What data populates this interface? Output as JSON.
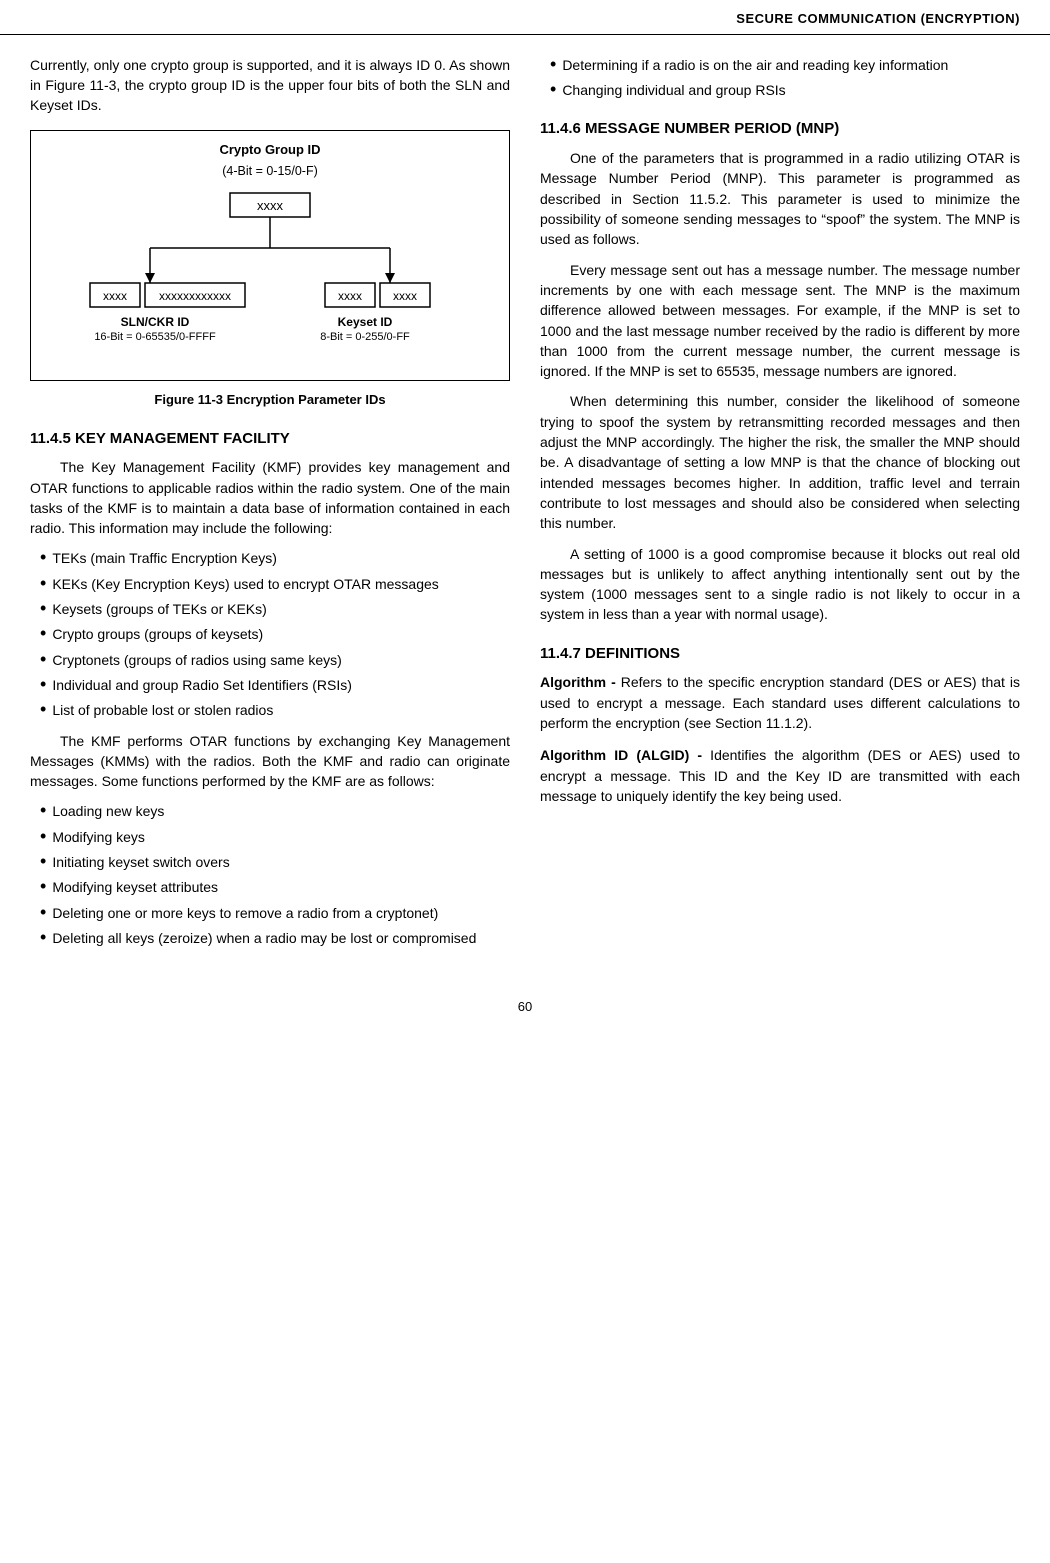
{
  "header": {
    "title": "SECURE COMMUNICATION (ENCRYPTION)"
  },
  "left_col": {
    "intro_paragraph": "Currently, only one crypto group is supported, and it is always ID 0. As shown in Figure 11-3, the crypto group ID is the upper four bits of both the SLN and Keyset IDs.",
    "diagram": {
      "title": "Crypto Group ID",
      "subtitle": "(4-Bit = 0-15/0-F)",
      "top_box": "xxxx",
      "left_boxes": [
        "xxxx",
        "xxxxxxxxxxxx"
      ],
      "right_boxes": [
        "xxxx",
        "xxxx"
      ],
      "left_id_label": "SLN/CKR ID",
      "left_id_sub": "16-Bit = 0-65535/0-FFFF",
      "right_id_label": "Keyset ID",
      "right_id_sub": "8-Bit = 0-255/0-FF"
    },
    "figure_caption": "Figure 11-3   Encryption Parameter IDs",
    "section_11_4_5": {
      "heading": "11.4.5  KEY MANAGEMENT FACILITY",
      "para1": "The Key Management Facility (KMF) provides key management and OTAR functions to applicable radios within the radio system. One of the main tasks of the KMF is to maintain a data base of information contained in each radio. This information may include the following:",
      "bullets": [
        "TEKs (main Traffic Encryption Keys)",
        "KEKs (Key Encryption Keys) used to encrypt OTAR messages",
        "Keysets (groups of TEKs or KEKs)",
        "Crypto groups (groups of keysets)",
        "Cryptonets (groups of radios using same keys)",
        "Individual and group Radio Set Identifiers (RSIs)",
        "List of probable lost or stolen radios"
      ],
      "para2": "The KMF performs OTAR functions by exchanging Key Management Messages (KMMs) with the radios. Both the KMF and radio can originate messages. Some functions performed by the KMF are as follows:",
      "bullets2": [
        "Loading new keys",
        "Modifying keys",
        "Initiating keyset switch overs",
        "Modifying keyset attributes",
        "Deleting one or more keys to remove a radio from a cryptonet)",
        "Deleting all keys (zeroize) when a radio may be lost or compromised"
      ]
    }
  },
  "right_col": {
    "bullets_top": [
      "Determining if a radio is on the air and reading key information",
      "Changing individual and group RSIs"
    ],
    "section_11_4_6": {
      "heading": "11.4.6  MESSAGE NUMBER PERIOD (MNP)",
      "para1": "One of the parameters that is programmed in a radio utilizing OTAR is Message Number Period (MNP). This parameter is programmed as described in Section 11.5.2. This parameter is used to minimize the possibility of someone sending messages to “spoof” the system. The MNP is used as follows.",
      "para2": "Every message sent out has a message number. The message number increments by one with each message sent. The MNP is the maximum difference allowed between messages. For example, if the MNP is set to 1000 and the last message number received by the radio is different by more than 1000 from the current message number, the current message is ignored. If the MNP is set to 65535, message numbers are ignored.",
      "para3": "When determining this number, consider the likelihood of someone trying to spoof the system by retransmitting recorded messages and then adjust the MNP accordingly. The higher the risk, the smaller the MNP should be. A disadvantage of setting a low MNP is that the chance of blocking out intended messages becomes higher. In addition, traffic level and terrain contribute to lost messages and should also be considered when selecting this number.",
      "para4": "A setting of 1000 is a good compromise because it blocks out real old messages but is unlikely to affect anything intentionally sent out by the system (1000 messages sent to a single radio is not likely to occur in a system in less than a year with normal usage)."
    },
    "section_11_4_7": {
      "heading": "11.4.7  DEFINITIONS",
      "def1_term": "Algorithm -",
      "def1_text": " Refers to the specific encryption standard (DES or AES) that is used to encrypt a message. Each standard uses different calculations to perform the encryption (see Section 11.1.2).",
      "def2_term": "Algorithm ID (ALGID) -",
      "def2_text": " Identifies the algorithm (DES or AES) used to encrypt a message. This ID and the Key ID are transmitted with each message to uniquely identify the key being used."
    }
  },
  "page_number": "60"
}
